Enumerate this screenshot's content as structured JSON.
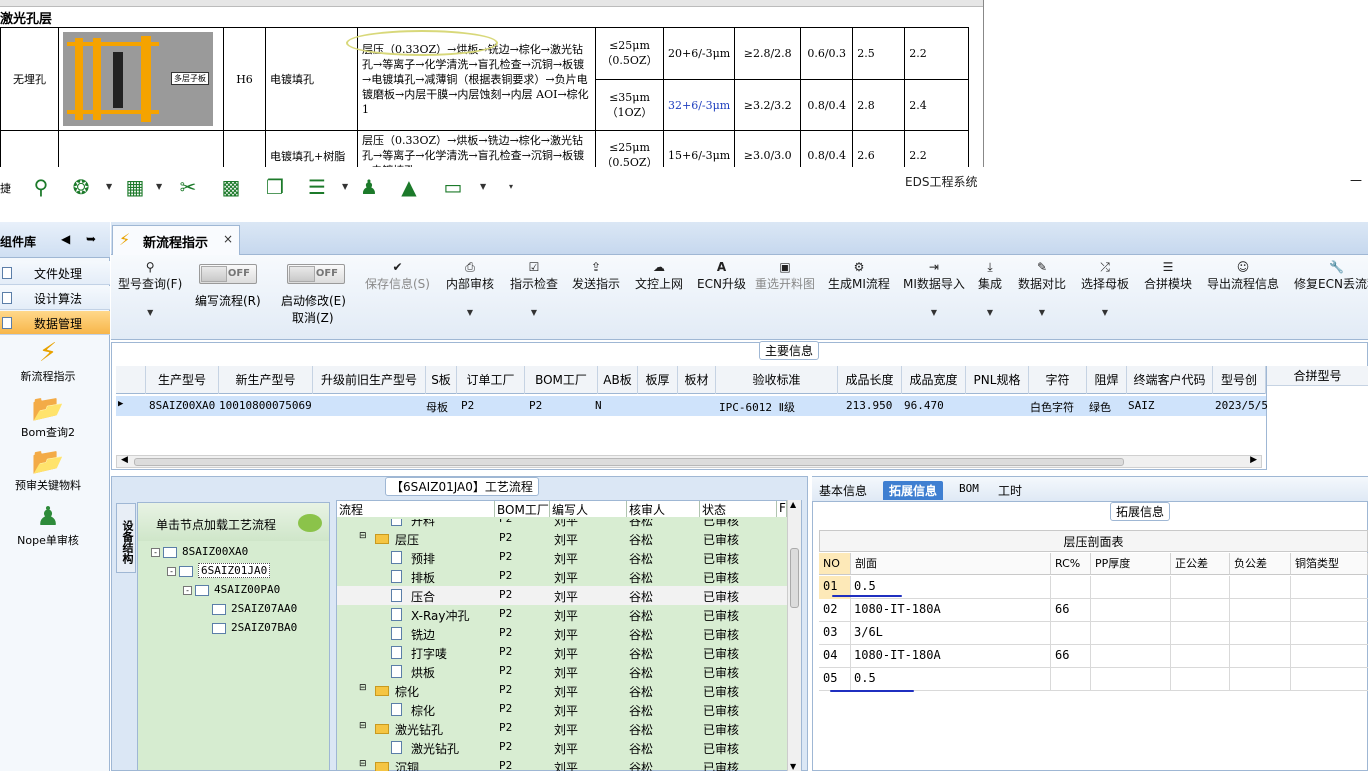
{
  "excel": {
    "section_title": "激光孔层",
    "row1": {
      "type": "无埋孔",
      "code": "H6",
      "process": "电镀填孔",
      "image_label": "多层子板",
      "flow": "层压（0.33OZ）→烘板→铣边→棕化→激光钻孔→等离子→化学清洗→盲孔检查→沉铜→板镀→电镀填孔→减薄铜（根据表铜要求）→负片电镀磨板→内层干膜→内层蚀刻→内层 AOI→棕化 1",
      "sub": [
        {
          "cu": "≤25μm（0.5OZ）",
          "tol": "20+6/-3μm",
          "ratio": "≥2.8/2.8",
          "v1": "0.6/0.3",
          "v2": "2.5",
          "v3": "2.2"
        },
        {
          "cu": "≤35μm（1OZ）",
          "tol": "32+6/-3μm",
          "ratio": "≥3.2/3.2",
          "v1": "0.8/0.4",
          "v2": "2.8",
          "v3": "2.4"
        }
      ]
    },
    "row2": {
      "process_partial": "电镀填孔+树脂",
      "flow": "层压（0.33OZ）→烘板→铣边→棕化→激光钻孔→等离子→化学清洗→盲孔检查→沉铜→板镀→电镀填孔→",
      "sub": {
        "cu": "≤25μm（0.5OZ）",
        "tol": "15+6/-3μm",
        "ratio": "≥3.0/3.0",
        "v1": "0.8/0.4",
        "v2": "2.6",
        "v3": "2.2"
      }
    }
  },
  "app": {
    "title": "EDS工程系统",
    "quick_left": "捷",
    "minimize": "—"
  },
  "left_panel": {
    "title": "组件库",
    "items": [
      {
        "label": "文件处理"
      },
      {
        "label": "设计算法"
      },
      {
        "label": "数据管理"
      }
    ],
    "tools": [
      {
        "label": "新流程指示",
        "icon": "lightning-icon"
      },
      {
        "label": "Bom查询2",
        "icon": "folder-icon"
      },
      {
        "label": "预审关键物料",
        "icon": "folder-icon"
      },
      {
        "label": "Nope单审核",
        "icon": "user-icon"
      }
    ]
  },
  "tab": {
    "label": "新流程指示",
    "close": "×"
  },
  "ribbon": {
    "model_query": "型号查询(F)",
    "toggle_off": "OFF",
    "write_flow": "编写流程(R)",
    "start_modify": "启动修改(E)",
    "cancel": "取消(Z)",
    "buttons": [
      {
        "label": "保存信息(S)",
        "icon": "✔"
      },
      {
        "label": "内部审核",
        "icon": "⎙"
      },
      {
        "label": "指示检查",
        "icon": "☑"
      },
      {
        "label": "发送指示",
        "icon": "⇪"
      },
      {
        "label": "文控上网",
        "icon": "☁"
      },
      {
        "label": "ECN升级",
        "icon": "A"
      },
      {
        "label": "重选开料图",
        "icon": "▣"
      },
      {
        "label": "生成MI流程",
        "icon": "⚙"
      },
      {
        "label": "MI数据导入",
        "icon": "⇥"
      },
      {
        "label": "集成",
        "icon": "⤓"
      },
      {
        "label": "数据对比",
        "icon": "✎"
      },
      {
        "label": "选择母板",
        "icon": "⤮"
      },
      {
        "label": "合拼模块",
        "icon": "☰"
      },
      {
        "label": "导出流程信息",
        "icon": "☺"
      },
      {
        "label": "修复ECN丢流程",
        "icon": "🔧"
      }
    ]
  },
  "main_info": {
    "title": "主要信息",
    "columns": [
      "生产型号",
      "新生产型号",
      "升级前旧生产型号",
      "S板",
      "订单工厂",
      "BOM工厂",
      "AB板",
      "板厚",
      "板材",
      "验收标准",
      "成品长度",
      "成品宽度",
      "PNL规格",
      "字符",
      "阻焊",
      "终端客户代码",
      "型号创"
    ],
    "combine_col": "合拼型号",
    "row": {
      "model": "8SAIZ00XA0",
      "new_model": "10010800075069",
      "old_model": "",
      "s_board": "母板",
      "order_factory": "P2",
      "bom_factory": "P2",
      "ab": "N",
      "thickness": "",
      "material": "",
      "standard": "IPC-6012 Ⅱ级",
      "length": "213.950",
      "width": "96.470",
      "pnl": "",
      "char": "白色字符",
      "mask": "绿色",
      "customer": "SAIZ",
      "created": "2023/5/5"
    }
  },
  "process": {
    "title": "【6SAIZ01JA0】工艺流程",
    "vtab": "设备结构",
    "hint": "单击节点加载工艺流程",
    "tree": [
      "8SAIZ00XA0",
      "6SAIZ01JA0",
      "4SAIZ00PA0",
      "2SAIZ07AA0",
      "2SAIZ07BA0"
    ],
    "columns": [
      "流程",
      "BOM工厂",
      "编写人",
      "核审人",
      "状态",
      "F"
    ],
    "rows": [
      {
        "name": "开料",
        "kind": "doc",
        "f": "P2",
        "w": "刘平",
        "r": "谷松",
        "s": "已审核"
      },
      {
        "name": "层压",
        "kind": "folder",
        "f": "P2",
        "w": "刘平",
        "r": "谷松",
        "s": "已审核"
      },
      {
        "name": "预排",
        "kind": "doc",
        "f": "P2",
        "w": "刘平",
        "r": "谷松",
        "s": "已审核"
      },
      {
        "name": "排板",
        "kind": "doc",
        "f": "P2",
        "w": "刘平",
        "r": "谷松",
        "s": "已审核"
      },
      {
        "name": "压合",
        "kind": "doc",
        "f": "P2",
        "w": "刘平",
        "r": "谷松",
        "s": "已审核"
      },
      {
        "name": "X-Ray冲孔",
        "kind": "doc",
        "f": "P2",
        "w": "刘平",
        "r": "谷松",
        "s": "已审核"
      },
      {
        "name": "铣边",
        "kind": "doc",
        "f": "P2",
        "w": "刘平",
        "r": "谷松",
        "s": "已审核"
      },
      {
        "name": "打字唛",
        "kind": "doc",
        "f": "P2",
        "w": "刘平",
        "r": "谷松",
        "s": "已审核"
      },
      {
        "name": "烘板",
        "kind": "doc",
        "f": "P2",
        "w": "刘平",
        "r": "谷松",
        "s": "已审核"
      },
      {
        "name": "棕化",
        "kind": "folder",
        "f": "P2",
        "w": "刘平",
        "r": "谷松",
        "s": "已审核"
      },
      {
        "name": "棕化",
        "kind": "doc",
        "f": "P2",
        "w": "刘平",
        "r": "谷松",
        "s": "已审核"
      },
      {
        "name": "激光钻孔",
        "kind": "folder",
        "f": "P2",
        "w": "刘平",
        "r": "谷松",
        "s": "已审核"
      },
      {
        "name": "激光钻孔",
        "kind": "doc",
        "f": "P2",
        "w": "刘平",
        "r": "谷松",
        "s": "已审核"
      },
      {
        "name": "沉铜",
        "kind": "folder",
        "f": "P2",
        "w": "刘平",
        "r": "谷松",
        "s": "已审核"
      }
    ]
  },
  "detail": {
    "tabs": [
      "基本信息",
      "拓展信息",
      "BOM",
      "工时"
    ],
    "ext_title": "拓展信息",
    "table_caption": "层压剖面表",
    "columns": [
      "NO",
      "剖面",
      "RC%",
      "PP厚度",
      "正公差",
      "负公差",
      "铜箔类型"
    ],
    "rows": [
      {
        "no": "01",
        "profile": "0.5",
        "rc": ""
      },
      {
        "no": "02",
        "profile": "1080-IT-180A",
        "rc": "66"
      },
      {
        "no": "03",
        "profile": "3/6L",
        "rc": ""
      },
      {
        "no": "04",
        "profile": "1080-IT-180A",
        "rc": "66"
      },
      {
        "no": "05",
        "profile": "0.5",
        "rc": ""
      }
    ]
  },
  "colors": {
    "accent": "#3f7fd1",
    "selected_row": "#cfe3fb",
    "tree_bg": "#d6ecd0",
    "annotation": "#1f2fc0"
  }
}
